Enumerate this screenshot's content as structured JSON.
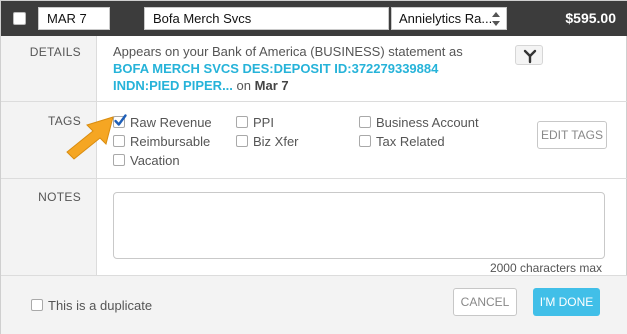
{
  "header": {
    "date": "MAR 7",
    "description": "Bofa Merch Svcs",
    "account_select": "Annielytics Ra...",
    "amount": "$595.00",
    "header_bg": "#3c3c3c"
  },
  "details": {
    "label": "DETAILS",
    "prefix": "Appears on your Bank of America (BUSINESS) statement as",
    "statement_text": "BOFA MERCH SVCS DES:DEPOSIT ID:372279339884 INDN:PIED PIPER...",
    "on_word": "on",
    "date": "Mar 7",
    "split_icon": "split-icon"
  },
  "tags": {
    "label": "TAGS",
    "items": [
      {
        "label": "Raw Revenue",
        "checked": true
      },
      {
        "label": "PPI",
        "checked": false
      },
      {
        "label": "Business Account",
        "checked": false
      },
      {
        "label": "Reimbursable",
        "checked": false
      },
      {
        "label": "Biz Xfer",
        "checked": false
      },
      {
        "label": "Tax Related",
        "checked": false
      },
      {
        "label": "Vacation",
        "checked": false
      }
    ],
    "edit_button": "EDIT TAGS"
  },
  "notes": {
    "label": "NOTES",
    "value": "",
    "char_limit": "2000 characters max"
  },
  "footer": {
    "duplicate_label": "This is a duplicate",
    "cancel": "CANCEL",
    "done": "I'M DONE",
    "accent": "#41bfe8",
    "link_color": "#26b3d9",
    "arrow_color": "#f5a623"
  }
}
